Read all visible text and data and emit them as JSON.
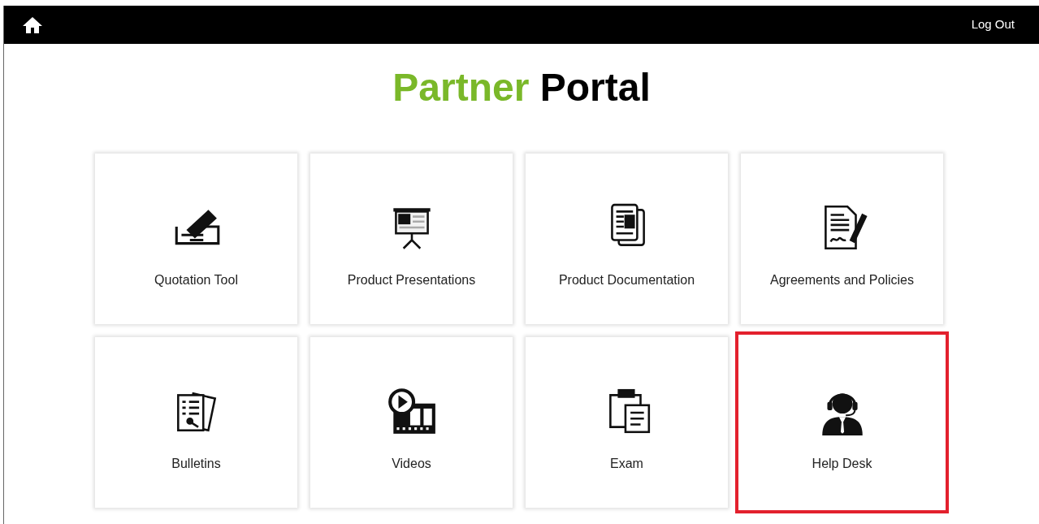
{
  "header": {
    "logout": "Log Out"
  },
  "title": {
    "accent": "Partner",
    "rest": "Portal"
  },
  "tiles": [
    {
      "label": "Quotation Tool",
      "kind": "quote",
      "highlighted": false
    },
    {
      "label": "Product Presentations",
      "kind": "presentation",
      "highlighted": false
    },
    {
      "label": "Product Documentation",
      "kind": "documents",
      "highlighted": false
    },
    {
      "label": "Agreements and Policies",
      "kind": "agreement",
      "highlighted": false
    },
    {
      "label": "Bulletins",
      "kind": "bulletins",
      "highlighted": false
    },
    {
      "label": "Videos",
      "kind": "video",
      "highlighted": false
    },
    {
      "label": "Exam",
      "kind": "exam",
      "highlighted": false
    },
    {
      "label": "Help Desk",
      "kind": "helpdesk",
      "highlighted": true
    }
  ]
}
